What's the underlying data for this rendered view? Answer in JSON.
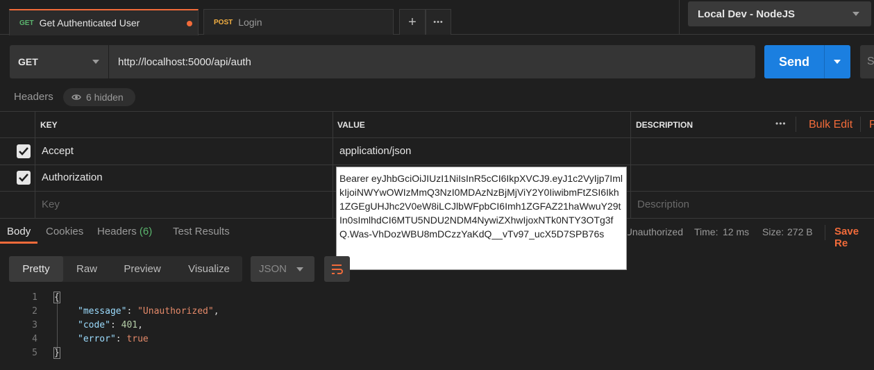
{
  "tabs": [
    {
      "method": "GET",
      "label": "Get Authenticated User"
    },
    {
      "method": "POST",
      "label": "Login"
    }
  ],
  "tabbar": {
    "add": "+",
    "more": "•••"
  },
  "environment": {
    "selected": "Local Dev - NodeJS"
  },
  "request": {
    "method": "GET",
    "url": "http://localhost:5000/api/auth",
    "send_label": "Send",
    "save_label": "S"
  },
  "headers_section": {
    "label": "Headers",
    "hidden": "6 hidden"
  },
  "headers_table": {
    "columns": [
      "KEY",
      "VALUE",
      "DESCRIPTION"
    ],
    "more": "•••",
    "bulk_edit": "Bulk Edit",
    "p_label": "P",
    "rows": [
      {
        "key": "Accept",
        "value": "application/json"
      },
      {
        "key": "Authorization",
        "value": ""
      }
    ],
    "key_placeholder": "Key",
    "description_placeholder": "Description"
  },
  "token_value": "Bearer eyJhbGciOiJIUzI1NiIsInR5cCI6IkpXVCJ9.eyJ1c2VyIjp7ImlkIjoiNWYwOWIzMmQ3NzI0MDAzNzBjMjViY2Y0IiwibmFtZSI6Ikh1ZGEgUHJhc2V0eW8iLCJlbWFpbCI6Imh1ZGFAZ21haWwuY29tIn0sImlhdCI6MTU5NDU2NDM4NywiZXhwIjoxNTk0NTY3OTg3fQ.Was-VhDozWBU8mDCzzYaKdQ__vTv97_ucX5D7SPB76s",
  "response_tabs": {
    "body": "Body",
    "cookies": "Cookies",
    "headers": "Headers",
    "headers_count": "(6)",
    "tests": "Test Results"
  },
  "response_meta": {
    "status": "Unauthorized",
    "time_label": "Time:",
    "time": "12 ms",
    "size_label": "Size:",
    "size": "272 B",
    "save": "Save Re"
  },
  "view_modes": [
    "Pretty",
    "Raw",
    "Preview",
    "Visualize"
  ],
  "format": "JSON",
  "code_lines": [
    "1",
    "2",
    "3",
    "4",
    "5"
  ],
  "code": {
    "open": "{",
    "k_message": "\"message\"",
    "v_message": "\"Unauthorized\"",
    "k_code": "\"code\"",
    "v_code": "401",
    "k_error": "\"error\"",
    "v_error": "true",
    "close": "}"
  },
  "colors": {
    "accent": "#f26b3a",
    "send": "#1b7fe0",
    "get": "#5bb56e",
    "post": "#f5b142"
  }
}
